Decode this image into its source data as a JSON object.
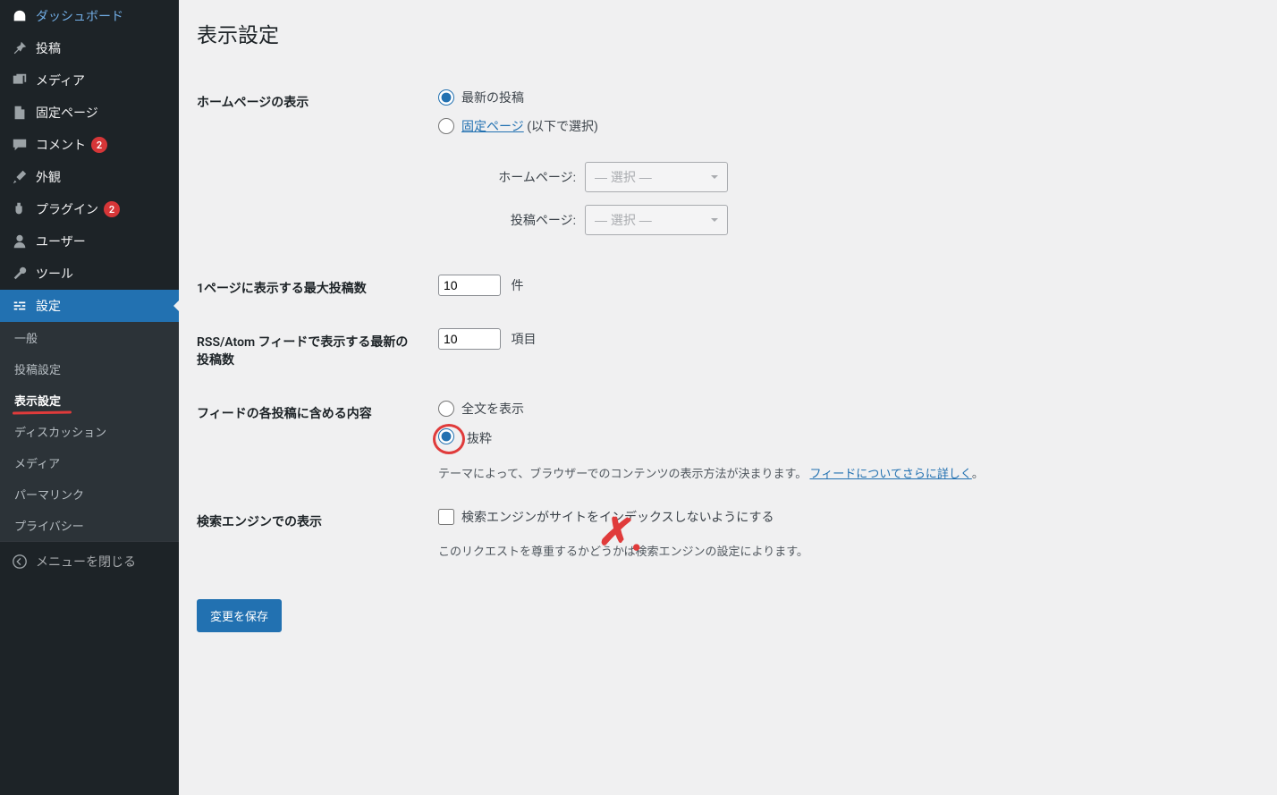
{
  "sidebar": {
    "items": [
      {
        "icon": "dashboard",
        "label": "ダッシュボード"
      },
      {
        "icon": "pin",
        "label": "投稿"
      },
      {
        "icon": "media",
        "label": "メディア"
      },
      {
        "icon": "page",
        "label": "固定ページ"
      },
      {
        "icon": "comment",
        "label": "コメント",
        "badge": "2"
      },
      {
        "icon": "appearance",
        "label": "外観"
      },
      {
        "icon": "plugin",
        "label": "プラグイン",
        "badge": "2"
      },
      {
        "icon": "user",
        "label": "ユーザー"
      },
      {
        "icon": "tool",
        "label": "ツール"
      },
      {
        "icon": "settings",
        "label": "設定",
        "active": true
      }
    ],
    "submenu": [
      {
        "label": "一般"
      },
      {
        "label": "投稿設定"
      },
      {
        "label": "表示設定",
        "current": true
      },
      {
        "label": "ディスカッション"
      },
      {
        "label": "メディア"
      },
      {
        "label": "パーマリンク"
      },
      {
        "label": "プライバシー"
      }
    ],
    "collapse_label": "メニューを閉じる"
  },
  "page": {
    "title": "表示設定",
    "homepage_display": {
      "label": "ホームページの表示",
      "option_latest": "最新の投稿",
      "option_static_link": "固定ページ",
      "option_static_suffix": " (以下で選択)",
      "homepage_label": "ホームページ:",
      "posts_page_label": "投稿ページ:",
      "select_placeholder": "— 選択 —"
    },
    "posts_per_page": {
      "label": "1ページに表示する最大投稿数",
      "value": "10",
      "unit": "件"
    },
    "rss_items": {
      "label": "RSS/Atom フィードで表示する最新の投稿数",
      "value": "10",
      "unit": "項目"
    },
    "feed_content": {
      "label": "フィードの各投稿に含める内容",
      "option_full": "全文を表示",
      "option_excerpt": "抜粋",
      "desc_prefix": "テーマによって、ブラウザーでのコンテンツの表示方法が決まります。",
      "desc_link": "フィードについてさらに詳しく",
      "desc_suffix": "。"
    },
    "search_engine": {
      "label": "検索エンジンでの表示",
      "checkbox_label": "検索エンジンがサイトをインデックスしないようにする",
      "desc": "このリクエストを尊重するかどうかは検索エンジンの設定によります。"
    },
    "submit_label": "変更を保存"
  }
}
